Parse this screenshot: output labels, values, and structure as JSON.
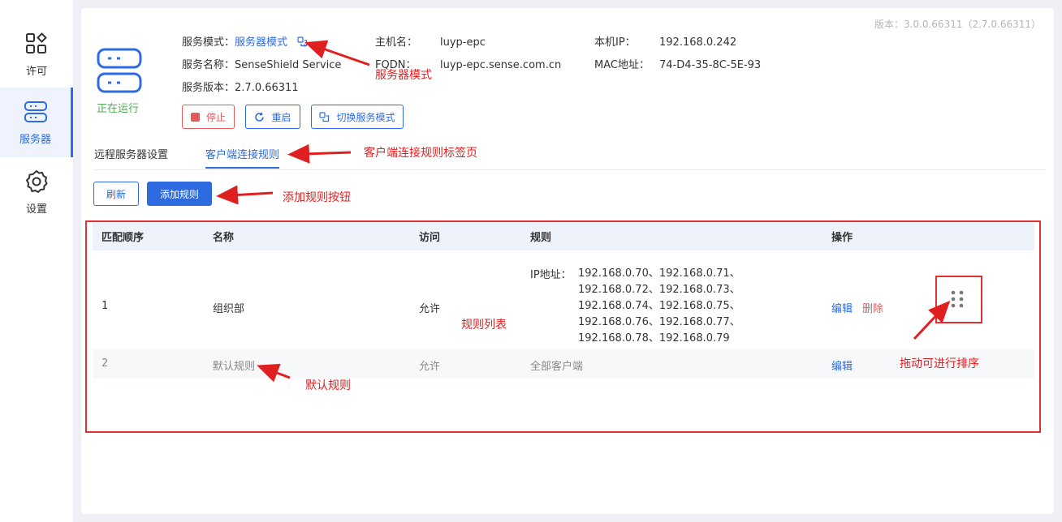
{
  "sidebar": {
    "items": [
      {
        "label": "许可",
        "icon": "license-grid-icon"
      },
      {
        "label": "服务器",
        "icon": "server-icon"
      },
      {
        "label": "设置",
        "icon": "gear-icon"
      }
    ]
  },
  "version": "版本：3.0.0.66311（2.7.0.66311）",
  "server": {
    "status": "正在运行",
    "mode_label": "服务模式：",
    "mode_value": "服务器模式",
    "name_label": "服务名称：",
    "name_value": "SenseShield Service",
    "ver_label": "服务版本：",
    "ver_value": "2.7.0.66311",
    "host_label": "主机名：",
    "host_value": "luyp-epc",
    "fqdn_label": "FQDN：",
    "fqdn_value": "luyp-epc.sense.com.cn",
    "ip_label": "本机IP：",
    "ip_value": "192.168.0.242",
    "mac_label": "MAC地址：",
    "mac_value": "74-D4-35-8C-5E-93"
  },
  "buttons": {
    "stop": "停止",
    "restart": "重启",
    "switch_mode": "切换服务模式",
    "refresh": "刷新",
    "add_rule": "添加规则"
  },
  "tabs": [
    {
      "label": "远程服务器设置"
    },
    {
      "label": "客户端连接规则"
    }
  ],
  "table": {
    "headers": [
      "匹配顺序",
      "名称",
      "访问",
      "规则",
      "操作"
    ],
    "rows": [
      {
        "order": "1",
        "name": "组织部",
        "access": "允许",
        "rule_prefix": "IP地址：",
        "rule_lines": [
          "192.168.0.70、192.168.0.71、",
          "192.168.0.72、192.168.0.73、",
          "192.168.0.74、192.168.0.75、",
          "192.168.0.76、192.168.0.77、",
          "192.168.0.78、192.168.0.79"
        ],
        "edit": "编辑",
        "delete": "删除"
      },
      {
        "order": "2",
        "name": "默认规则",
        "access": "允许",
        "rule": "全部客户端",
        "edit": "编辑"
      }
    ]
  },
  "annotations": {
    "server_mode": "服务器模式",
    "tab": "客户端连接规则标签页",
    "add_button": "添加规则按钮",
    "rule_list": "规则列表",
    "default_rule": "默认规则",
    "drag_sort": "拖动可进行排序"
  },
  "colors": {
    "accent": "#2f6be0",
    "danger": "#e35b5b",
    "running": "#4caf50",
    "annotation": "#e02020"
  }
}
